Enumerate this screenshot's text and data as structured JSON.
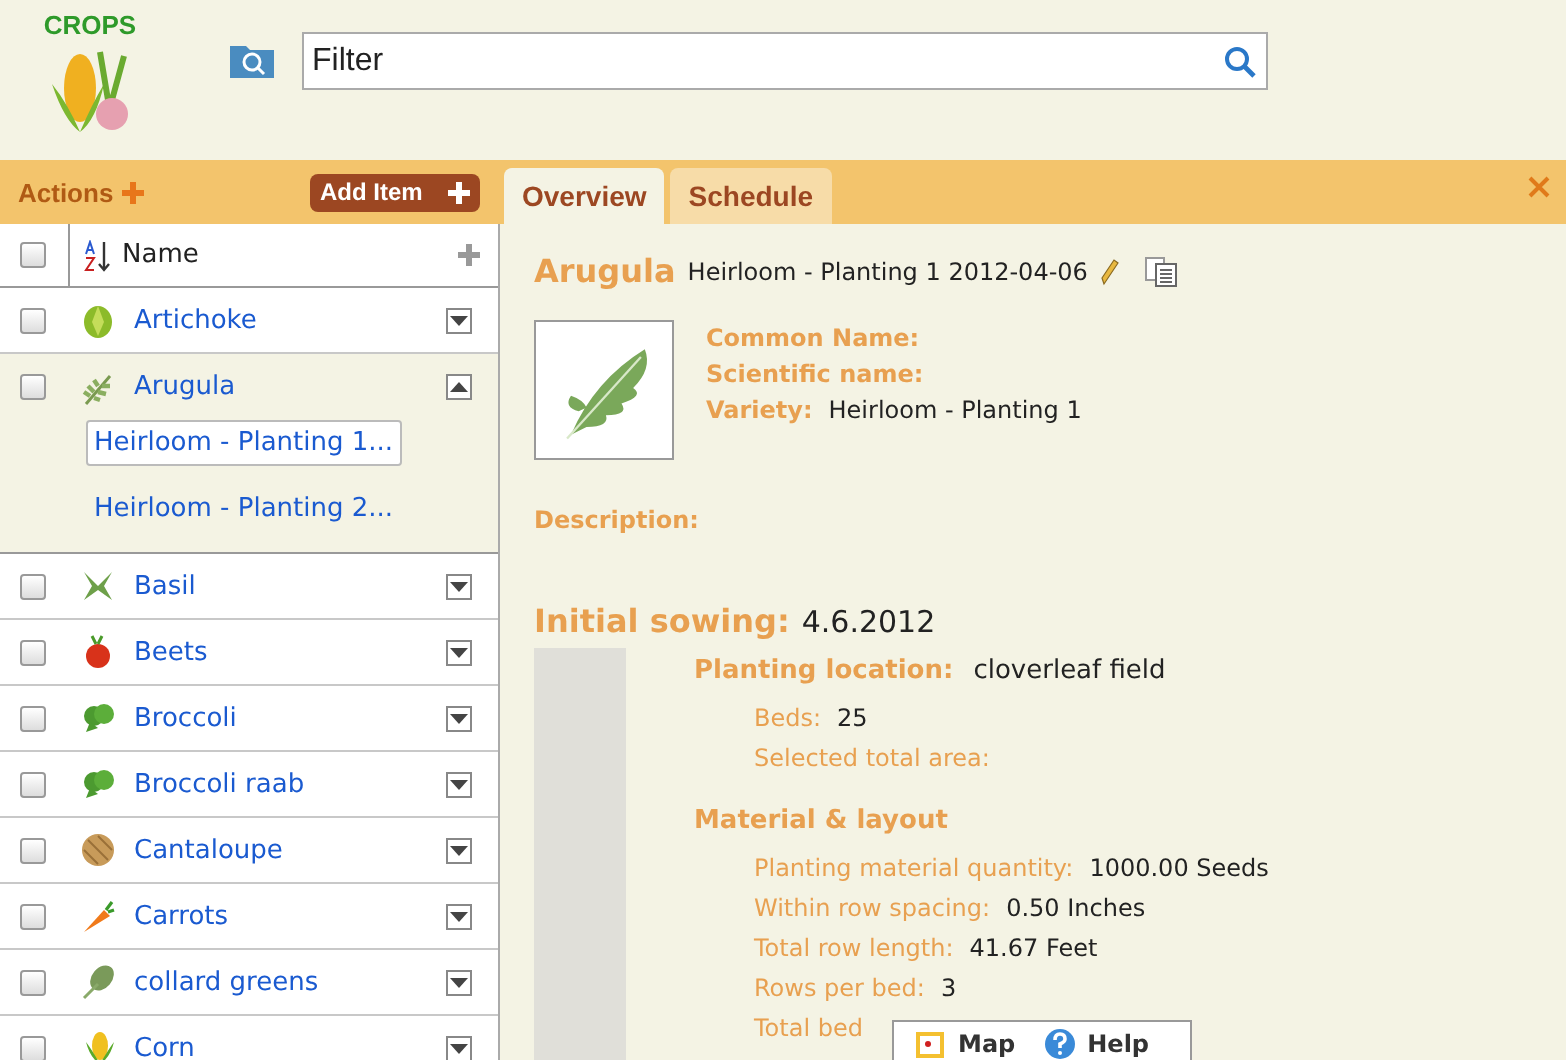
{
  "header": {
    "logo_text": "CROPS",
    "filter": {
      "placeholder": "Filter"
    }
  },
  "toolbar": {
    "actions": "Actions",
    "add_item": "Add Item"
  },
  "list": {
    "header": {
      "checked": false,
      "column": "Name"
    },
    "items": [
      {
        "name": "Artichoke",
        "checked": false,
        "expanded": false
      },
      {
        "name": "Arugula",
        "checked": false,
        "expanded": true,
        "children": [
          {
            "name": "Heirloom - Planting 1...",
            "selected": true
          },
          {
            "name": "Heirloom - Planting 2...",
            "selected": false
          }
        ]
      },
      {
        "name": "Basil",
        "checked": false,
        "expanded": false
      },
      {
        "name": "Beets",
        "checked": false,
        "expanded": false
      },
      {
        "name": "Broccoli",
        "checked": false,
        "expanded": false
      },
      {
        "name": "Broccoli raab",
        "checked": false,
        "expanded": false
      },
      {
        "name": "Cantaloupe",
        "checked": false,
        "expanded": false
      },
      {
        "name": "Carrots",
        "checked": false,
        "expanded": false
      },
      {
        "name": "collard greens",
        "checked": false,
        "expanded": false
      },
      {
        "name": "Corn",
        "checked": false,
        "expanded": false
      }
    ]
  },
  "tabs": [
    {
      "label": "Overview",
      "selected": true
    },
    {
      "label": "Schedule",
      "selected": false
    }
  ],
  "detail": {
    "title": "Arugula",
    "subtitle": "Heirloom - Planting 1 2012-04-06",
    "fields": [
      {
        "label": "Common Name:"
      },
      {
        "label": "Scientific name:"
      },
      {
        "label": "Variety:",
        "value": "Heirloom - Planting 1"
      }
    ],
    "description_label": "Description:",
    "sowing": {
      "label": "Initial sowing:",
      "value": "4.6.2012"
    },
    "location": {
      "label": "Planting location:",
      "value": "cloverleaf field"
    },
    "location_fields": [
      {
        "label": "Beds:",
        "value": "25"
      },
      {
        "label": "Selected total area:"
      }
    ],
    "material_heading": "Material & layout",
    "material_fields": [
      {
        "label": "Planting material quantity:",
        "value": "1000.00 Seeds"
      },
      {
        "label": "Within row spacing:",
        "value": "0.50 Inches"
      },
      {
        "label": "Total row length:",
        "value": "41.67 Feet"
      },
      {
        "label": "Rows per bed:",
        "value": "3"
      },
      {
        "label": "Total bed"
      }
    ]
  },
  "popup": {
    "buttons": [
      "Map",
      "Help"
    ]
  }
}
